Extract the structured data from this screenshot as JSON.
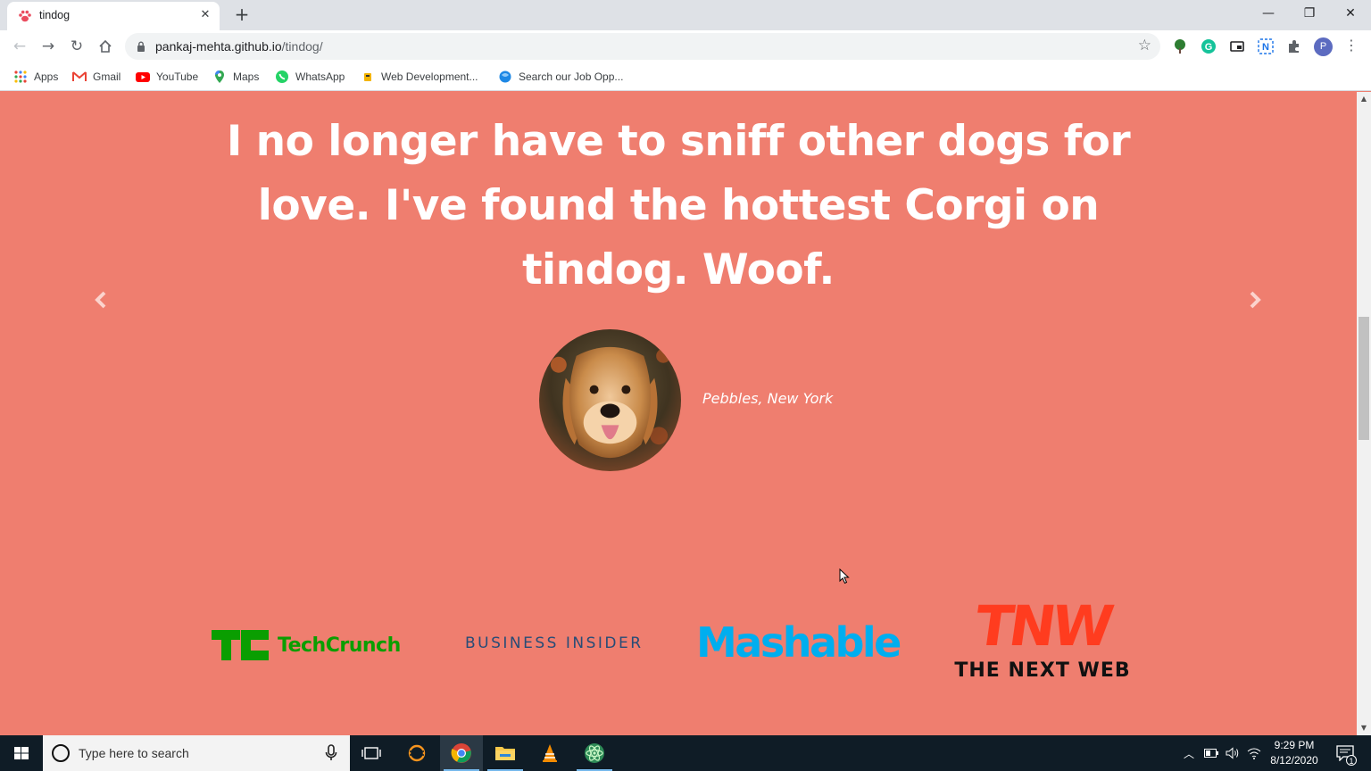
{
  "browser": {
    "tab_title": "tindog",
    "new_tab_symbol": "+",
    "url_host": "pankaj-mehta.github.io",
    "url_path": "/tindog/",
    "window_controls": {
      "minimize": "—",
      "restore": "❐",
      "close": "✕"
    }
  },
  "bookmarks": [
    {
      "label": "Apps",
      "icon": "apps-grid-icon"
    },
    {
      "label": "Gmail",
      "icon": "gmail-icon"
    },
    {
      "label": "YouTube",
      "icon": "youtube-icon"
    },
    {
      "label": "Maps",
      "icon": "maps-icon"
    },
    {
      "label": "WhatsApp",
      "icon": "whatsapp-icon"
    },
    {
      "label": "Web Development...",
      "icon": "web-dev-icon"
    },
    {
      "label": "Search our Job Opp...",
      "icon": "job-search-icon"
    }
  ],
  "profile_initial": "P",
  "testimonial": {
    "quote": "I no longer have to sniff other dogs for love. I've found the hottest Corgi on tindog. Woof.",
    "author": "Pebbles, New York"
  },
  "press": {
    "techcrunch": "TechCrunch",
    "business_insider": "BUSINESS INSIDER",
    "mashable": "Mashable",
    "tnw_big": "TNW",
    "tnw_small": "THE NEXT WEB"
  },
  "taskbar": {
    "search_placeholder": "Type here to search",
    "time": "9:29 PM",
    "date": "8/12/2020",
    "notification_count": "1"
  },
  "colors": {
    "page_bg": "#ef7e6f",
    "techcrunch_green": "#0a9e01",
    "mashable_blue": "#00aeef",
    "tnw_red": "#ff3c1f"
  }
}
